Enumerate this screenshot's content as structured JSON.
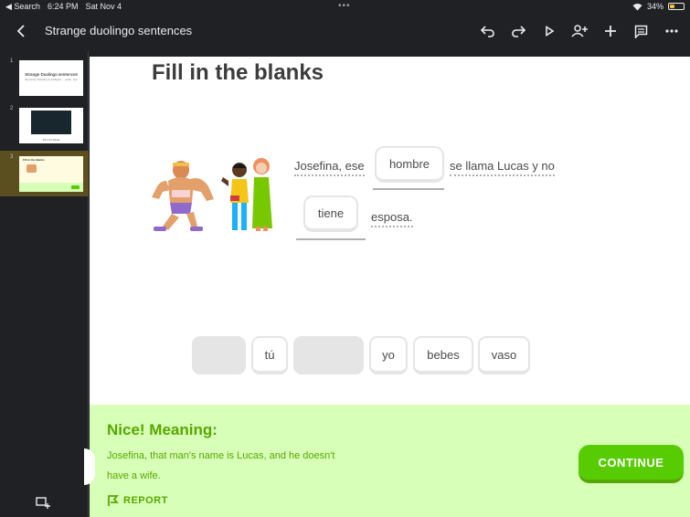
{
  "status_bar": {
    "back_app": "◀ Search",
    "time": "6:24 PM",
    "date": "Sat Nov 4",
    "battery_percent": "34%",
    "battery_level": 0.34
  },
  "toolbar": {
    "title": "Strange duolingo sentences",
    "icons": [
      "back-icon",
      "undo-icon",
      "redo-icon",
      "play-icon",
      "add-person-icon",
      "add-icon",
      "comment-icon",
      "more-icon"
    ]
  },
  "slides": [
    {
      "number": "1",
      "thumb_title": "Strange Duolingo sentences",
      "thumb_subtitle": "By prompt. Focusing on duolingo's ... Lucas - Ayo"
    },
    {
      "number": "2",
      "thumb_caption": "Fill in the blanks"
    },
    {
      "number": "3",
      "thumb_caption": "Fill in the blanks"
    }
  ],
  "exercise": {
    "heading": "Fill in the blanks",
    "sentence": {
      "part1": "Josefina, ese",
      "blank1": "hombre",
      "part2": "se llama Lucas y no",
      "blank2": "tiene",
      "part3": "esposa."
    },
    "word_bank": [
      {
        "text": "",
        "state": "used"
      },
      {
        "text": "tú",
        "state": "available"
      },
      {
        "text": "",
        "state": "used"
      },
      {
        "text": "yo",
        "state": "available"
      },
      {
        "text": "bebes",
        "state": "available"
      },
      {
        "text": "vaso",
        "state": "available"
      }
    ]
  },
  "feedback": {
    "title": "Nice! Meaning:",
    "meaning_line1": "Josefina, that man's name is Lucas, and he doesn't",
    "meaning_line2": "have a wife.",
    "continue_label": "CONTINUE",
    "report_label": "REPORT"
  },
  "colors": {
    "toolbar_bg": "#202124",
    "feedback_bg": "#d7ffb8",
    "success_green": "#58a700",
    "button_green": "#58cc02",
    "selected_slide": "#5b4e1f"
  }
}
